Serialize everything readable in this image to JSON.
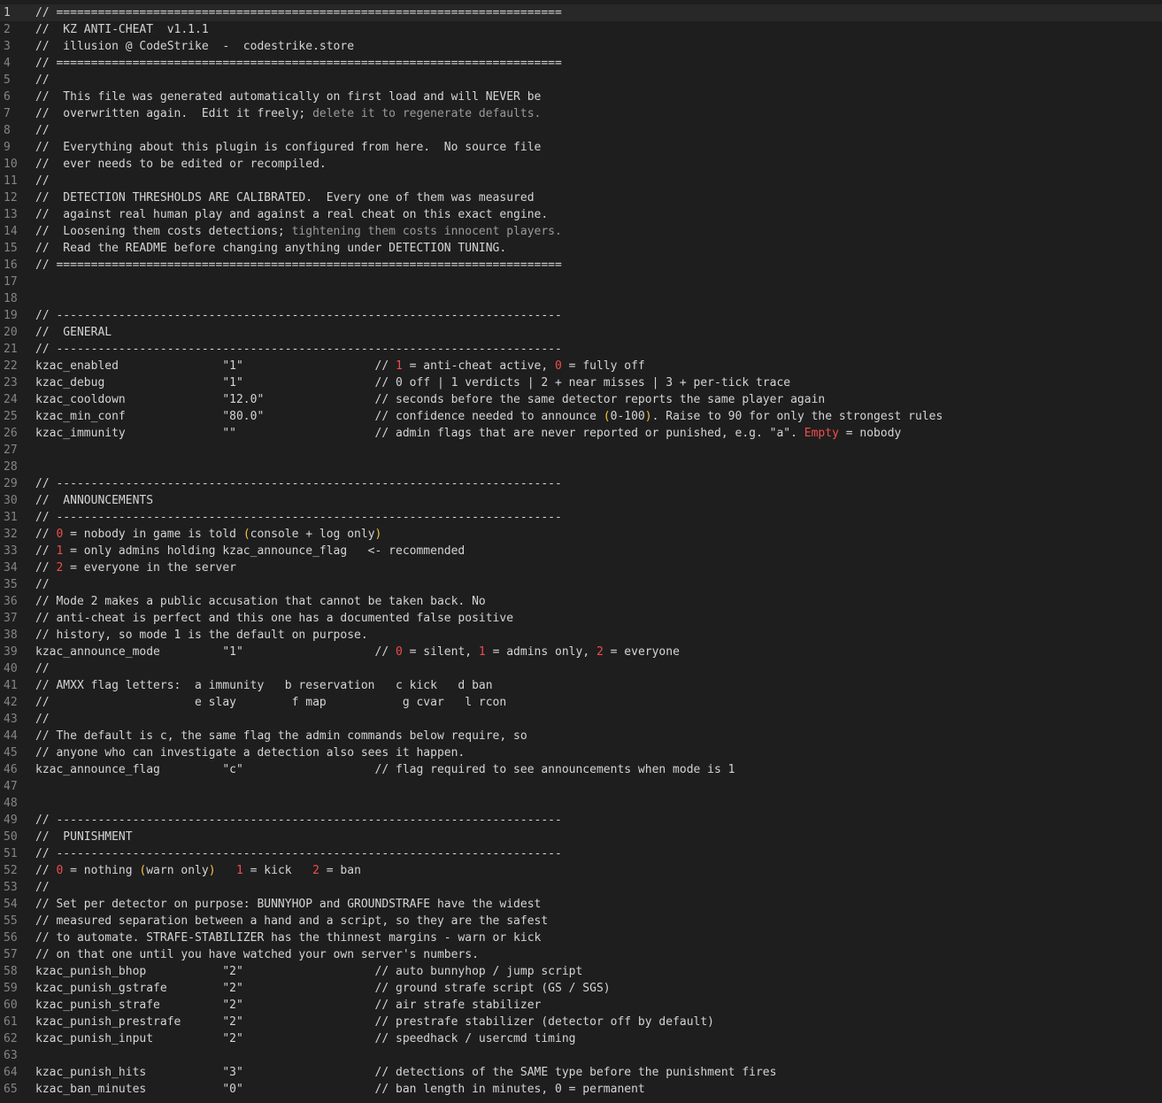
{
  "editor": {
    "lines": [
      {
        "n": "1",
        "segs": [
          [
            "t",
            "// ========================================================================="
          ]
        ]
      },
      {
        "n": "2",
        "segs": [
          [
            "t",
            "//  KZ ANTI-CHEAT  v1.1.1"
          ]
        ]
      },
      {
        "n": "3",
        "segs": [
          [
            "t",
            "//  illusion @ CodeStrike  -  codestrike.store"
          ]
        ]
      },
      {
        "n": "4",
        "segs": [
          [
            "t",
            "// ========================================================================="
          ]
        ]
      },
      {
        "n": "5",
        "segs": [
          [
            "t",
            "//"
          ]
        ]
      },
      {
        "n": "6",
        "segs": [
          [
            "t",
            "//  This file was generated automatically on first load and will NEVER be"
          ]
        ]
      },
      {
        "n": "7",
        "segs": [
          [
            "t",
            "//  overwritten again.  Edit it freely;"
          ],
          [
            "dim",
            " delete it to regenerate defaults."
          ]
        ]
      },
      {
        "n": "8",
        "segs": [
          [
            "t",
            "//"
          ]
        ]
      },
      {
        "n": "9",
        "segs": [
          [
            "t",
            "//  Everything about this plugin is configured from here.  No source file"
          ]
        ]
      },
      {
        "n": "10",
        "segs": [
          [
            "t",
            "//  ever needs to be edited or recompiled."
          ]
        ]
      },
      {
        "n": "11",
        "segs": [
          [
            "t",
            "//"
          ]
        ]
      },
      {
        "n": "12",
        "segs": [
          [
            "t",
            "//  DETECTION THRESHOLDS ARE CALIBRATED.  Every one of them was measured"
          ]
        ]
      },
      {
        "n": "13",
        "segs": [
          [
            "t",
            "//  against real human play and against a real cheat on this exact engine."
          ]
        ]
      },
      {
        "n": "14",
        "segs": [
          [
            "t",
            "//  Loosening them costs detections;"
          ],
          [
            "dim",
            " tightening them costs innocent players."
          ]
        ]
      },
      {
        "n": "15",
        "segs": [
          [
            "t",
            "//  Read the README before changing anything under DETECTION TUNING."
          ]
        ]
      },
      {
        "n": "16",
        "segs": [
          [
            "t",
            "// ========================================================================="
          ]
        ]
      },
      {
        "n": "17",
        "segs": []
      },
      {
        "n": "18",
        "segs": []
      },
      {
        "n": "19",
        "segs": [
          [
            "t",
            "// -------------------------------------------------------------------------"
          ]
        ]
      },
      {
        "n": "20",
        "segs": [
          [
            "t",
            "//  GENERAL"
          ]
        ]
      },
      {
        "n": "21",
        "segs": [
          [
            "t",
            "// -------------------------------------------------------------------------"
          ]
        ]
      },
      {
        "n": "22",
        "segs": [
          [
            "t",
            "kzac_enabled               \"1\"                   // "
          ],
          [
            "num",
            "1"
          ],
          [
            "t",
            " = anti-cheat active, "
          ],
          [
            "num",
            "0"
          ],
          [
            "t",
            " = fully off"
          ]
        ]
      },
      {
        "n": "23",
        "segs": [
          [
            "t",
            "kzac_debug                 \"1\"                   // 0 off | 1 verdicts | 2 + near misses | 3 + per-tick trace"
          ]
        ]
      },
      {
        "n": "24",
        "segs": [
          [
            "t",
            "kzac_cooldown              \"12.0\"                // seconds before the same detector reports the same player again"
          ]
        ]
      },
      {
        "n": "25",
        "segs": [
          [
            "t",
            "kzac_min_conf              \"80.0\"                // confidence needed to announce "
          ],
          [
            "paren",
            "("
          ],
          [
            "t",
            "0-100"
          ],
          [
            "paren",
            ")"
          ],
          [
            "t",
            ". Raise to 90 for only the strongest rules"
          ]
        ]
      },
      {
        "n": "26",
        "segs": [
          [
            "t",
            "kzac_immunity              \"\"                    // admin flags that are never reported or punished, e.g. \"a\". "
          ],
          [
            "num",
            "Empty"
          ],
          [
            "t",
            " = nobody"
          ]
        ]
      },
      {
        "n": "27",
        "segs": []
      },
      {
        "n": "28",
        "segs": []
      },
      {
        "n": "29",
        "segs": [
          [
            "t",
            "// -------------------------------------------------------------------------"
          ]
        ]
      },
      {
        "n": "30",
        "segs": [
          [
            "t",
            "//  ANNOUNCEMENTS"
          ]
        ]
      },
      {
        "n": "31",
        "segs": [
          [
            "t",
            "// -------------------------------------------------------------------------"
          ]
        ]
      },
      {
        "n": "32",
        "segs": [
          [
            "t",
            "// "
          ],
          [
            "num",
            "0"
          ],
          [
            "t",
            " = nobody in game is told "
          ],
          [
            "paren",
            "("
          ],
          [
            "t",
            "console + log only"
          ],
          [
            "paren",
            ")"
          ]
        ]
      },
      {
        "n": "33",
        "segs": [
          [
            "t",
            "// "
          ],
          [
            "num",
            "1"
          ],
          [
            "t",
            " = only admins holding kzac_announce_flag   <- recommended"
          ]
        ]
      },
      {
        "n": "34",
        "segs": [
          [
            "t",
            "// "
          ],
          [
            "num",
            "2"
          ],
          [
            "t",
            " = everyone in the server"
          ]
        ]
      },
      {
        "n": "35",
        "segs": [
          [
            "t",
            "//"
          ]
        ]
      },
      {
        "n": "36",
        "segs": [
          [
            "t",
            "// Mode 2 makes a public accusation that cannot be taken back. No"
          ]
        ]
      },
      {
        "n": "37",
        "segs": [
          [
            "t",
            "// anti-cheat is perfect and this one has a documented false positive"
          ]
        ]
      },
      {
        "n": "38",
        "segs": [
          [
            "t",
            "// history, so mode 1 is the default on purpose."
          ]
        ]
      },
      {
        "n": "39",
        "segs": [
          [
            "t",
            "kzac_announce_mode         \"1\"                   // "
          ],
          [
            "num",
            "0"
          ],
          [
            "t",
            " = silent, "
          ],
          [
            "num",
            "1"
          ],
          [
            "t",
            " = admins only, "
          ],
          [
            "num",
            "2"
          ],
          [
            "t",
            " = everyone"
          ]
        ]
      },
      {
        "n": "40",
        "segs": [
          [
            "t",
            "//"
          ]
        ]
      },
      {
        "n": "41",
        "segs": [
          [
            "t",
            "// AMXX flag letters:  a immunity   b reservation   c kick   d ban"
          ]
        ]
      },
      {
        "n": "42",
        "segs": [
          [
            "t",
            "//                     e slay        f map           g cvar   l rcon"
          ]
        ]
      },
      {
        "n": "43",
        "segs": [
          [
            "t",
            "//"
          ]
        ]
      },
      {
        "n": "44",
        "segs": [
          [
            "t",
            "// The default is c, the same flag the admin commands below require, so"
          ]
        ]
      },
      {
        "n": "45",
        "segs": [
          [
            "t",
            "// anyone who can investigate a detection also sees it happen."
          ]
        ]
      },
      {
        "n": "46",
        "segs": [
          [
            "t",
            "kzac_announce_flag         \"c\"                   // flag required to see announcements when mode is 1"
          ]
        ]
      },
      {
        "n": "47",
        "segs": []
      },
      {
        "n": "48",
        "segs": []
      },
      {
        "n": "49",
        "segs": [
          [
            "t",
            "// -------------------------------------------------------------------------"
          ]
        ]
      },
      {
        "n": "50",
        "segs": [
          [
            "t",
            "//  PUNISHMENT"
          ]
        ]
      },
      {
        "n": "51",
        "segs": [
          [
            "t",
            "// -------------------------------------------------------------------------"
          ]
        ]
      },
      {
        "n": "52",
        "segs": [
          [
            "t",
            "// "
          ],
          [
            "num",
            "0"
          ],
          [
            "t",
            " = nothing "
          ],
          [
            "paren",
            "("
          ],
          [
            "t",
            "warn only"
          ],
          [
            "paren",
            ")"
          ],
          [
            "t",
            "   "
          ],
          [
            "num",
            "1"
          ],
          [
            "t",
            " = kick   "
          ],
          [
            "num",
            "2"
          ],
          [
            "t",
            " = ban"
          ]
        ]
      },
      {
        "n": "53",
        "segs": [
          [
            "t",
            "//"
          ]
        ]
      },
      {
        "n": "54",
        "segs": [
          [
            "t",
            "// Set per detector on purpose: BUNNYHOP and GROUNDSTRAFE have the widest"
          ]
        ]
      },
      {
        "n": "55",
        "segs": [
          [
            "t",
            "// measured separation between a hand and a script, so they are the safest"
          ]
        ]
      },
      {
        "n": "56",
        "segs": [
          [
            "t",
            "// to automate. STRAFE-STABILIZER has the thinnest margins - warn or kick"
          ]
        ]
      },
      {
        "n": "57",
        "segs": [
          [
            "t",
            "// on that one until you have watched your own server's numbers."
          ]
        ]
      },
      {
        "n": "58",
        "segs": [
          [
            "t",
            "kzac_punish_bhop           \"2\"                   // auto bunnyhop / jump script"
          ]
        ]
      },
      {
        "n": "59",
        "segs": [
          [
            "t",
            "kzac_punish_gstrafe        \"2\"                   // ground strafe script (GS / SGS)"
          ]
        ]
      },
      {
        "n": "60",
        "segs": [
          [
            "t",
            "kzac_punish_strafe         \"2\"                   // air strafe stabilizer"
          ]
        ]
      },
      {
        "n": "61",
        "segs": [
          [
            "t",
            "kzac_punish_prestrafe      \"2\"                   // prestrafe stabilizer (detector off by default)"
          ]
        ]
      },
      {
        "n": "62",
        "segs": [
          [
            "t",
            "kzac_punish_input          \"2\"                   // speedhack / usercmd timing"
          ]
        ]
      },
      {
        "n": "63",
        "segs": []
      },
      {
        "n": "64",
        "segs": [
          [
            "t",
            "kzac_punish_hits           \"3\"                   // detections of the SAME type before the punishment fires"
          ]
        ]
      },
      {
        "n": "65",
        "segs": [
          [
            "t",
            "kzac_ban_minutes           \"0\"                   // ban length in minutes, 0 = permanent"
          ]
        ]
      }
    ]
  }
}
